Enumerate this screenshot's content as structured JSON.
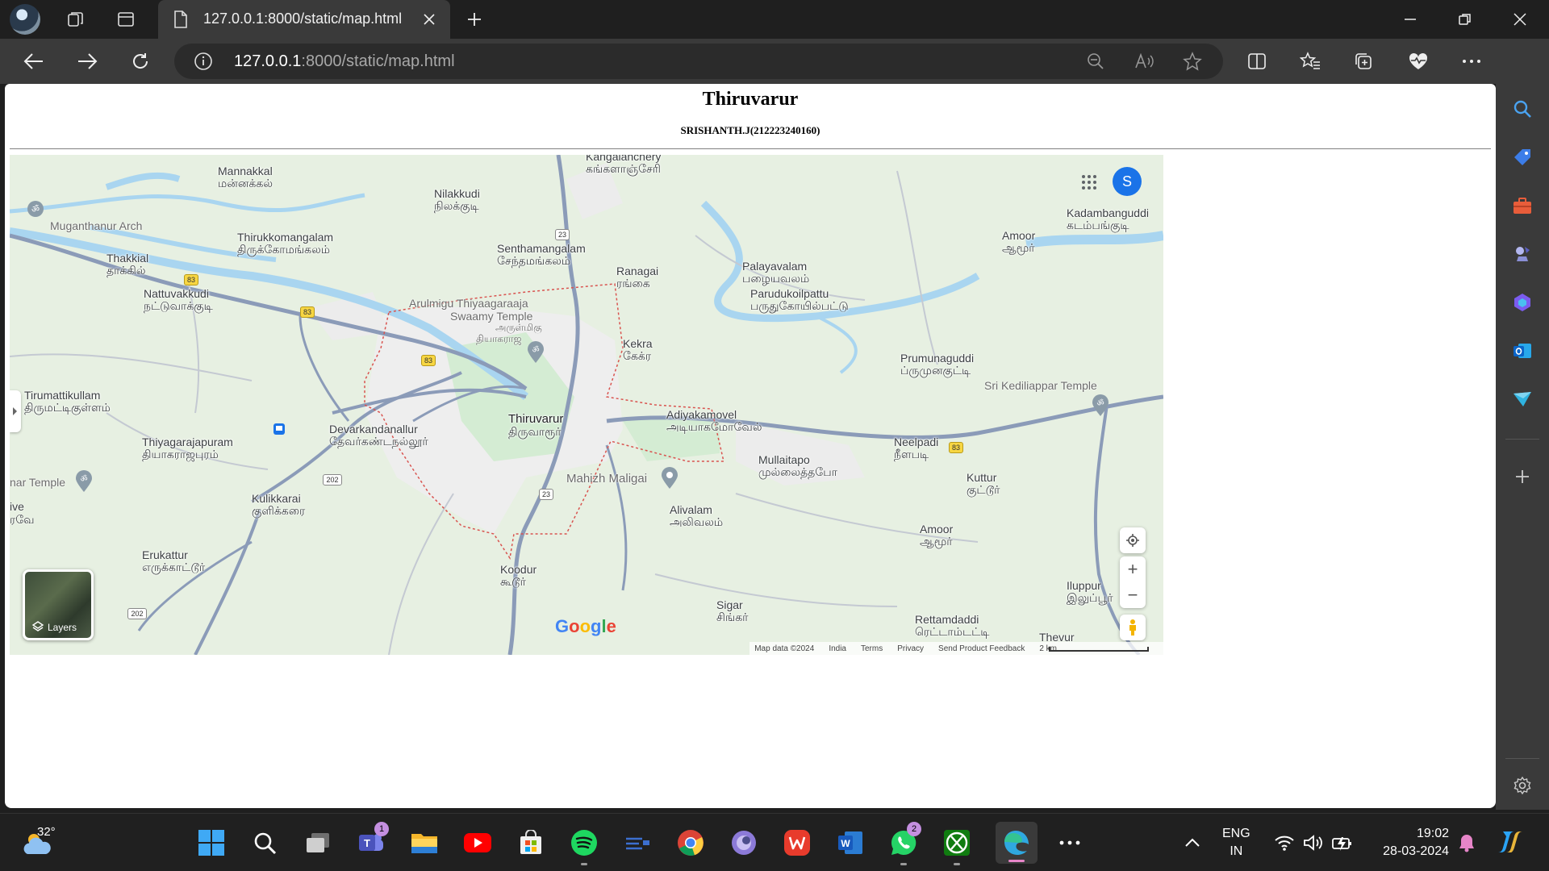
{
  "browser": {
    "tab": {
      "title": "127.0.0.1:8000/static/map.html"
    },
    "address": {
      "host": "127.0.0.1",
      "path": ":8000/static/map.html"
    }
  },
  "page": {
    "heading": "Thiruvarur",
    "subheading": "SRISHANTH.J(212223240160)"
  },
  "map": {
    "places": [
      {
        "en": "Mannakkal",
        "ta": "மன்னக்கல்"
      },
      {
        "en": "Nilakkudi",
        "ta": "நிலக்குடி"
      },
      {
        "en": "Kangalanchery",
        "ta": "கங்களாஞ்சேரி"
      },
      {
        "en": "Kadambanguddi",
        "ta": "கடம்பங்குடி"
      },
      {
        "en": "Amoor",
        "ta": "ஆமூர்"
      },
      {
        "en": "Thirukkomangalam",
        "ta": "திருக்கோமங்கலம்"
      },
      {
        "en": "Senthamangalam",
        "ta": "சேந்தமங்கலம்"
      },
      {
        "en": "Thakkial",
        "ta": "தாக்கில்"
      },
      {
        "en": "Palayavalam",
        "ta": "பழையவலம்"
      },
      {
        "en": "Ranagai",
        "ta": "ரங்கை"
      },
      {
        "en": "Nattuvakkudi",
        "ta": "நட்டுவாக்குடி"
      },
      {
        "en": "Parudukoilpattu",
        "ta": "பருதுகோயில்பட்டு"
      },
      {
        "en": "Kekra",
        "ta": "கேக்ர"
      },
      {
        "en": "Prumunaguddi",
        "ta": "ப்ருமுனகுட்டி"
      },
      {
        "en": "Tirumattikullam",
        "ta": "திருமட்டிகுள்ளம்"
      },
      {
        "en": "Adiyakamovel",
        "ta": "அடியாகமோவேல்"
      },
      {
        "en": "Thiruvarur",
        "ta": "திருவாரூர்"
      },
      {
        "en": "Devarkandanallur",
        "ta": "தேவர்கண்டநல்லூர்"
      },
      {
        "en": "Thiyagarajapuram",
        "ta": "தியாகராஜபுரம்"
      },
      {
        "en": "Neelpadi",
        "ta": "நீளபடி"
      },
      {
        "en": "Mullaitapo",
        "ta": "முல்லைத்தபோ"
      },
      {
        "en": "Kuttur",
        "ta": "குட்டூர்"
      },
      {
        "en": "Kulikkarai",
        "ta": "குளிக்கரை"
      },
      {
        "en": "Alivalam",
        "ta": "அலிவலம்"
      },
      {
        "en": "Amoor",
        "ta": "ஆமூர்"
      },
      {
        "en": "Erukattur",
        "ta": "எருக்காட்டூர்"
      },
      {
        "en": "Koodur",
        "ta": "கூடூர்"
      },
      {
        "en": "Iluppur",
        "ta": "இலுப்பூர்"
      },
      {
        "en": "Sigar",
        "ta": "சிங்கர்"
      },
      {
        "en": "Rettamdaddi",
        "ta": "ரெட்டாம்டட்டி"
      },
      {
        "en": "Thevur",
        "ta": ""
      }
    ],
    "pois": {
      "muganthanur": "Muganthanur Arch",
      "temple_line1": "Arulmigu Thiyaagaraaja",
      "temple_line2": "Swaamy Temple",
      "temple_ta1": "அருள்மிகு",
      "temple_ta2": "தியாகராஜ",
      "kediliappar": "Sri Kediliappar Temple",
      "mahizh": "Mahizh Maligai",
      "left_temple": "nar Temple",
      "left_ve": "ive",
      "left_ve_ta": "ரவே"
    },
    "shields": [
      "83",
      "83",
      "83",
      "23",
      "23",
      "202",
      "202",
      "83"
    ],
    "account_initial": "S",
    "layers_label": "Layers",
    "logo": "Google",
    "footer": [
      "Map data ©2024",
      "India",
      "Terms",
      "Privacy",
      "Send Product Feedback",
      "2 km"
    ]
  },
  "taskbar": {
    "weather": "32°",
    "badges": {
      "teams": "1",
      "whatsapp": "2"
    },
    "lang1": "ENG",
    "lang2": "IN",
    "time": "19:02",
    "date": "28-03-2024"
  }
}
